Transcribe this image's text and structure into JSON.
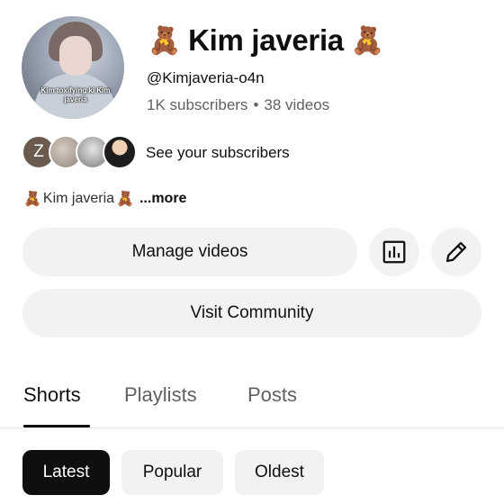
{
  "channel": {
    "avatar_caption": "Kim toxifying ki Kim javeria",
    "name": "Kim javeria",
    "name_emoji_left": "🧸",
    "name_emoji_right": "🧸",
    "handle": "@Kimjaveria-o4n",
    "subscribers": "1K subscribers",
    "separator": "•",
    "videos": "38 videos"
  },
  "subscribers_row": {
    "first_initial": "Z",
    "label": "See your subscribers"
  },
  "description": {
    "emoji": "🧸",
    "text": "Kim javeria",
    "more": "...more"
  },
  "actions": {
    "manage_label": "Manage videos",
    "community_label": "Visit Community",
    "analytics_icon": "analytics-icon",
    "edit_icon": "pencil-icon"
  },
  "tabs": [
    {
      "label": "Shorts",
      "active": true
    },
    {
      "label": "Playlists",
      "active": false
    },
    {
      "label": "Posts",
      "active": false
    }
  ],
  "filters": [
    {
      "label": "Latest",
      "selected": true
    },
    {
      "label": "Popular",
      "selected": false
    },
    {
      "label": "Oldest",
      "selected": false
    }
  ]
}
